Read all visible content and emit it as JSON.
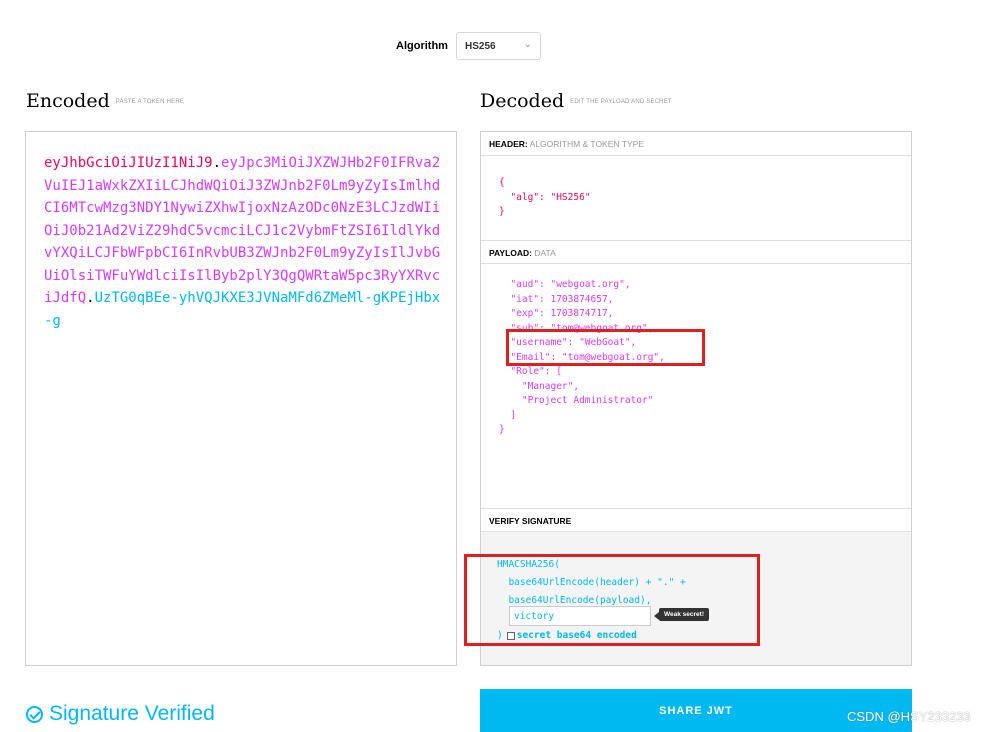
{
  "algorithm": {
    "label": "Algorithm",
    "value": "HS256"
  },
  "encoded": {
    "title": "Encoded",
    "subtitle": "PASTE A TOKEN HERE",
    "header_part": "eyJhbGciOiJIUzI1NiJ9",
    "payload_part": "eyJpc3MiOiJXZWJHb2F0IFRva2VuIEJ1aWxkZXIiLCJhdWQiOiJ3ZWJnb2F0Lm9yZyIsImlhdCI6MTcwMzg3NDY1NywiZXhwIjoxNzAzODc0NzE3LCJzdWIiOiJ0b21Ad2ViZ29hdC5vcmciLCJ1c2VybmFtZSI6IldlYkdvYXQiLCJFbWFpbCI6InRvbUB3ZWJnb2F0Lm9yZyIsIlJvbGUiOlsiTWFuYWdlciIsIlByb2plY3QgQWRtaW5pc3RyYXRvciJdfQ",
    "signature_part": "UzTG0qBEe-yhVQJKXE3JVNaMFd6ZMeMl-gKPEjHbx-g",
    "dot": "."
  },
  "decoded": {
    "title": "Decoded",
    "subtitle": "EDIT THE PAYLOAD AND SECRET",
    "header_section": {
      "title": "HEADER:",
      "subtitle": "ALGORITHM & TOKEN TYPE"
    },
    "header_json": "{\n  \"alg\": \"HS256\"\n}",
    "payload_section": {
      "title": "PAYLOAD:",
      "subtitle": "DATA"
    },
    "payload_json": "  \"aud\": \"webgoat.org\",\n  \"iat\": 1703874657,\n  \"exp\": 1703874717,\n  \"sub\": \"tom@webgoat.org\",\n  \"username\": \"WebGoat\",\n  \"Email\": \"tom@webgoat.org\",\n  \"Role\": [\n    \"Manager\",\n    \"Project Administrator\"\n  ]\n}",
    "verify_section": {
      "title": "VERIFY SIGNATURE"
    },
    "verify_code": "HMACSHA256(\n  base64UrlEncode(header) + \".\" +\n  base64UrlEncode(payload),",
    "secret_value": "victory",
    "weak_badge": "Weak secret!",
    "close_paren": ")",
    "secret_b64_label": "secret base64 encoded"
  },
  "status": {
    "label": "Signature Verified"
  },
  "share_button": {
    "label": "SHARE JWT"
  },
  "watermark": "CSDN @HSY233233",
  "colors": {
    "header": "#fb015b",
    "payload": "#d63aff",
    "signature": "#00b9f1",
    "highlight": "#e02020"
  }
}
